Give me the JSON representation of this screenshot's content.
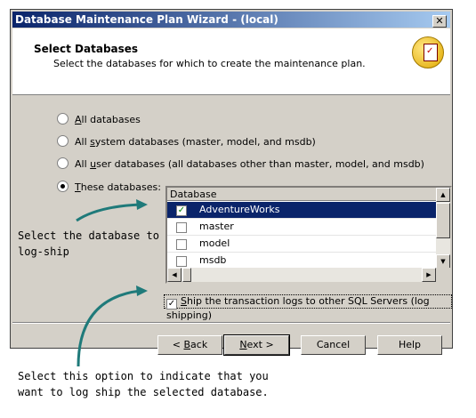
{
  "window": {
    "title": "Database Maintenance Plan Wizard - (local)",
    "close_label": "✕"
  },
  "header": {
    "title": "Select Databases",
    "subtitle": "Select the databases for which to create the maintenance plan.",
    "icon": "maintenance-plan-icon"
  },
  "options": [
    {
      "label_u": "A",
      "label_rest": "ll databases",
      "selected": false
    },
    {
      "label_pre": "All ",
      "label_u": "s",
      "label_rest": "ystem databases (master, model, and msdb)",
      "selected": false
    },
    {
      "label_pre": "All ",
      "label_u": "u",
      "label_rest": "ser databases (all databases other than master, model, and msdb)",
      "selected": false
    },
    {
      "label_u": "T",
      "label_rest": "hese databases:",
      "selected": true
    }
  ],
  "database_list": {
    "column_header": "Database",
    "rows": [
      {
        "name": "AdventureWorks",
        "checked": true,
        "selected": true
      },
      {
        "name": "master",
        "checked": false,
        "selected": false
      },
      {
        "name": "model",
        "checked": false,
        "selected": false
      },
      {
        "name": "msdb",
        "checked": false,
        "selected": false
      }
    ]
  },
  "log_shipping": {
    "checked": true,
    "label_u": "S",
    "label_rest": "hip the transaction logs to other SQL Servers (log shipping)"
  },
  "buttons": {
    "back_u": "B",
    "back_pre": "< ",
    "back_rest": "ack",
    "next_u": "N",
    "next_rest": "ext >",
    "cancel": "Cancel",
    "help": "Help"
  },
  "callouts": {
    "database": [
      "Select the database to",
      "log-ship"
    ],
    "option": [
      "Select this option to indicate that you",
      "want to log ship the selected database."
    ]
  },
  "colors": {
    "title_gradient_start": "#0a246a",
    "title_gradient_end": "#a6caf0",
    "selection": "#0a246a",
    "arrow": "#1f7a7a"
  }
}
